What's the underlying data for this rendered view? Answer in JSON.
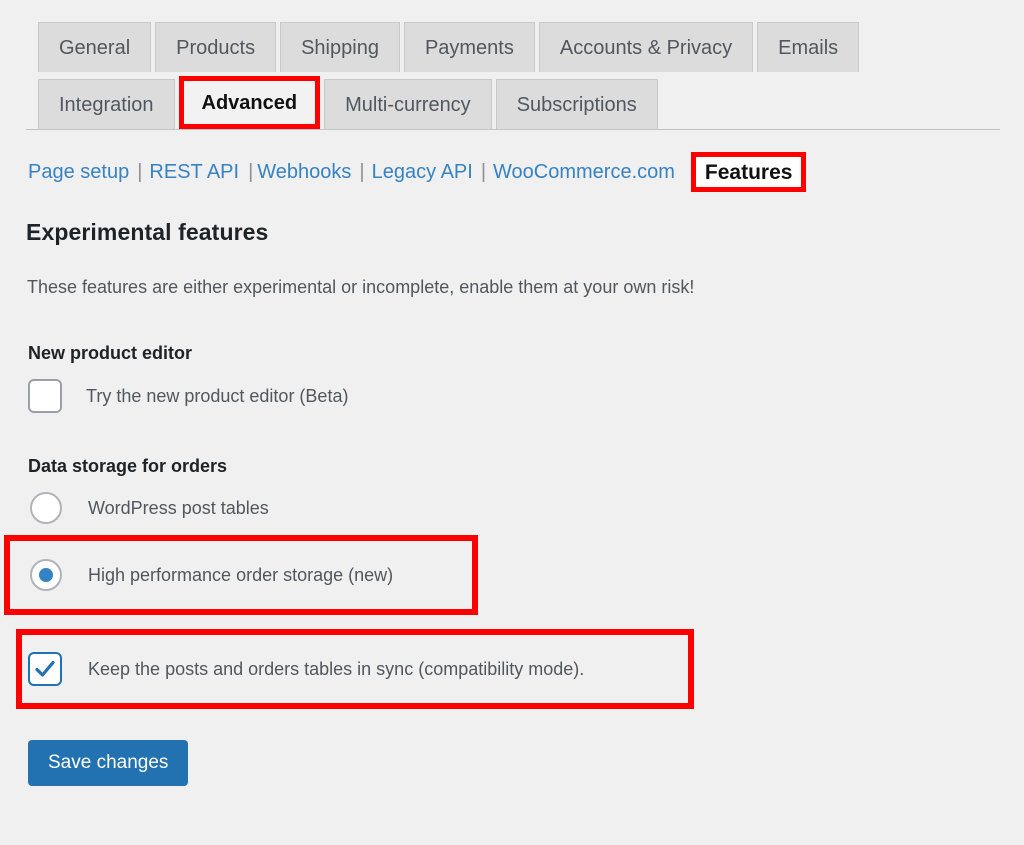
{
  "tabs": {
    "row1": [
      {
        "label": "General",
        "active": false,
        "highlighted": false
      },
      {
        "label": "Products",
        "active": false,
        "highlighted": false
      },
      {
        "label": "Shipping",
        "active": false,
        "highlighted": false
      },
      {
        "label": "Payments",
        "active": false,
        "highlighted": false
      },
      {
        "label": "Accounts & Privacy",
        "active": false,
        "highlighted": false
      },
      {
        "label": "Emails",
        "active": false,
        "highlighted": false
      }
    ],
    "row2": [
      {
        "label": "Integration",
        "active": false,
        "highlighted": false
      },
      {
        "label": "Advanced",
        "active": true,
        "highlighted": true
      },
      {
        "label": "Multi-currency",
        "active": false,
        "highlighted": false
      },
      {
        "label": "Subscriptions",
        "active": false,
        "highlighted": false
      }
    ]
  },
  "subnav": {
    "links": [
      {
        "label": "Page setup"
      },
      {
        "label": "REST API"
      },
      {
        "label": "Webhooks"
      },
      {
        "label": "Legacy API"
      },
      {
        "label": "WooCommerce.com"
      }
    ],
    "separator": "|",
    "active": {
      "label": "Features",
      "highlighted": true
    }
  },
  "main": {
    "title": "Experimental features",
    "description": "These features are either experimental or incomplete, enable them at your own risk!",
    "sections": {
      "new_product_editor": {
        "title": "New product editor",
        "checkbox": {
          "label": "Try the new product editor (Beta)",
          "checked": false
        }
      },
      "data_storage": {
        "title": "Data storage for orders",
        "options": [
          {
            "label": "WordPress post tables",
            "selected": false,
            "highlighted": false
          },
          {
            "label": "High performance order storage (new)",
            "selected": true,
            "highlighted": true
          }
        ],
        "sync_checkbox": {
          "label": "Keep the posts and orders tables in sync (compatibility mode).",
          "checked": true,
          "highlighted": true
        }
      }
    },
    "save_button": {
      "label": "Save changes"
    }
  },
  "colors": {
    "page_background": "#f0f0f0",
    "tab_background": "#dcdcdc",
    "link_blue": "#3582c4",
    "accent_blue": "#2271b1",
    "annotation_red": "#ff0000",
    "text_primary": "#1d2327",
    "text_secondary": "#50575e"
  }
}
